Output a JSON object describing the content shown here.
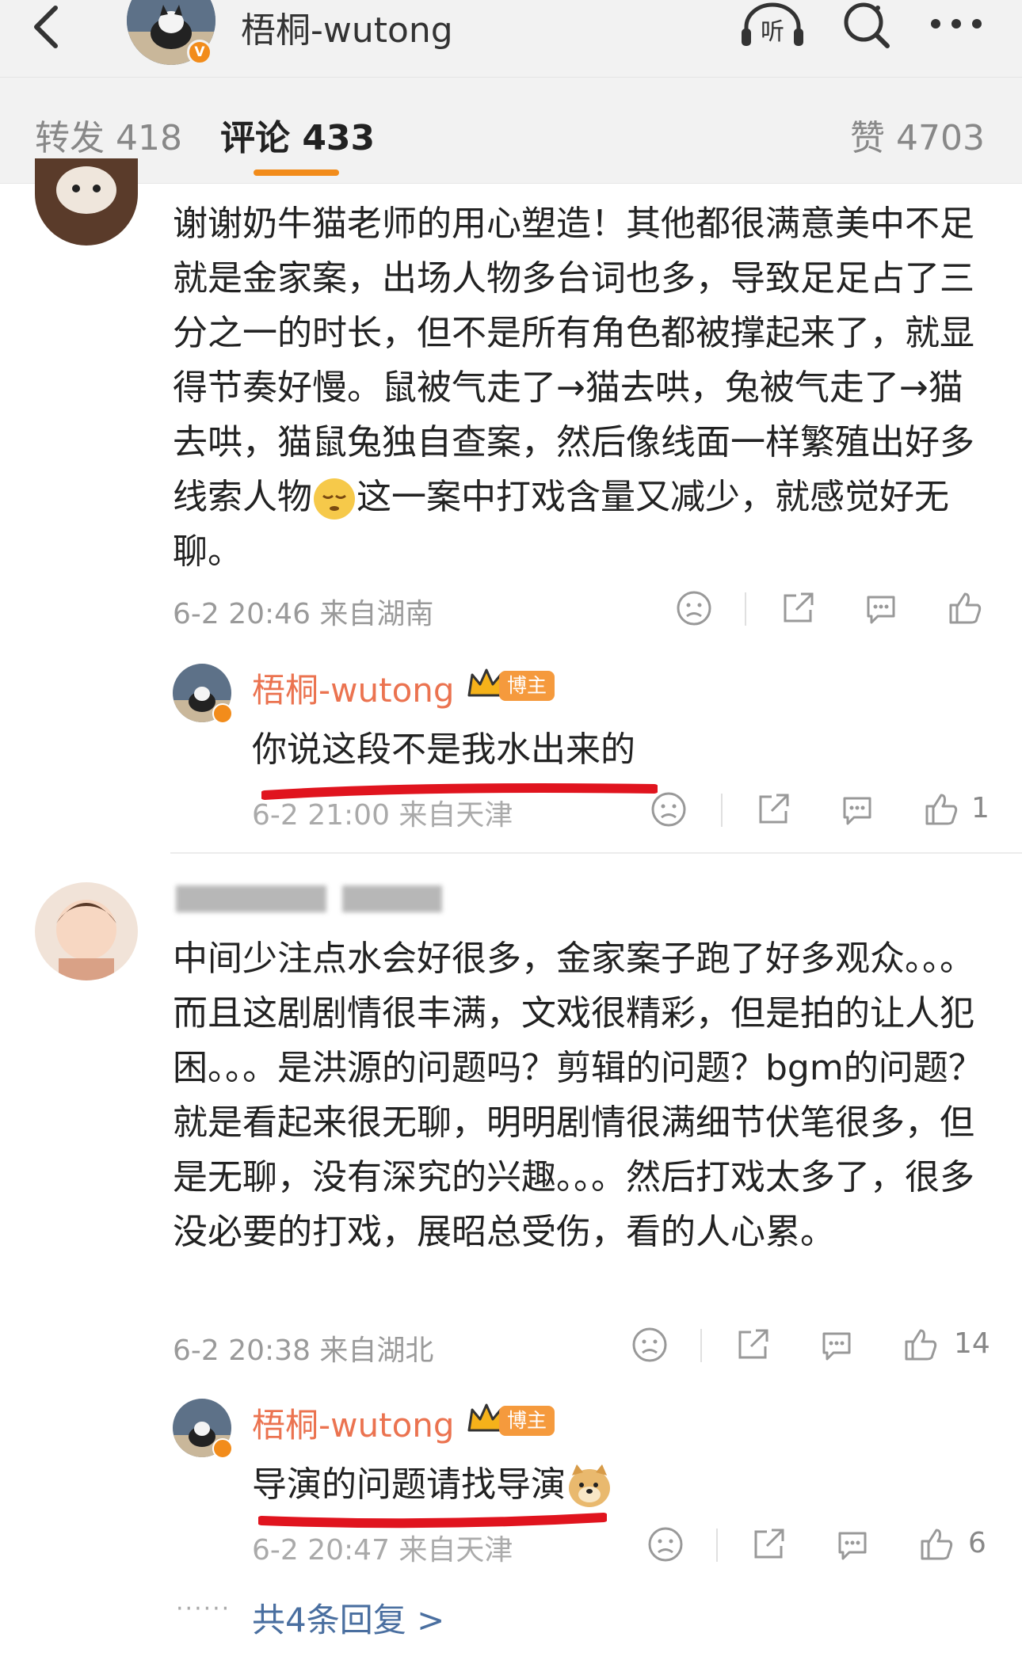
{
  "header": {
    "title": "梧桐-wutong",
    "badge": "V",
    "listen_label": "听"
  },
  "tabs": {
    "repost": "转发 418",
    "comment": "评论 433",
    "like": "赞 4703"
  },
  "comments": [
    {
      "text": "谢谢奶牛猫老师的用心塑造！其他都很满意美中不足就是金家案，出场人物多台词也多，导致足足占了三分之一的时长，但不是所有角色都被撑起来了，就显得节奏好慢。鼠被气走了→猫去哄，兔被气走了→猫去哄，猫鼠兔独自查案，然后像线面一样繁殖出好多线索人物",
      "text_after_emoji": "这一案中打戏含量又减少，就感觉好无聊。",
      "meta": "6-2 20:46 来自湖南",
      "like_count": "",
      "reply": {
        "name": "梧桐-wutong",
        "tag": "博主",
        "text": "你说这段不是我水出来的",
        "meta": "6-2 21:00 来自天津",
        "like_count": "1"
      }
    },
    {
      "text": "中间少注点水会好很多，金家案子跑了好多观众。。。而且这剧剧情很丰满，文戏很精彩，但是拍的让人犯困。。。是洪源的问题吗？剪辑的问题？bgm的问题？就是看起来很无聊，明明剧情很满细节伏笔很多，但是无聊，没有深究的兴趣。。。然后打戏太多了，很多没必要的打戏，展昭总受伤，看的人心累。",
      "meta": "6-2 20:38 来自湖北",
      "like_count": "14",
      "reply": {
        "name": "梧桐-wutong",
        "tag": "博主",
        "text": "导演的问题请找导演",
        "meta": "6-2 20:47 来自天津",
        "like_count": "6"
      },
      "more_replies": "共4条回复 >"
    }
  ],
  "colors": {
    "accent": "#f28c1b",
    "username": "#eb7350",
    "link": "#4a6fa0",
    "underline_mark": "#e0141e"
  }
}
